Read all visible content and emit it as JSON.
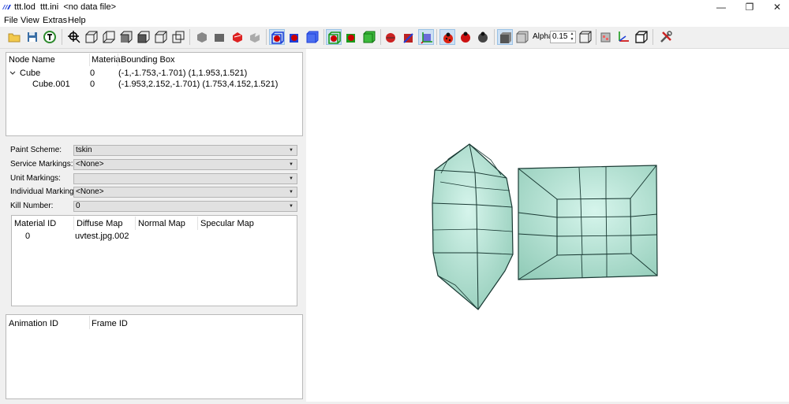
{
  "window": {
    "title": "ttt.lod  ttt.ini  <no data file>",
    "controls": {
      "minimize": "—",
      "restore": "❐",
      "close": "✕"
    }
  },
  "menu": [
    "File",
    "View",
    "Extras",
    "Help"
  ],
  "toolbar": {
    "alpha_label": "Alpha:",
    "alpha_value": "0.15",
    "accent": "#1e3fd8"
  },
  "node_tree": {
    "columns": [
      "Node Name",
      "Materia",
      "Bounding Box"
    ],
    "rows": [
      {
        "name": "Cube",
        "material": "0",
        "bbox": "(-1,-1.753,-1.701) (1,1.953,1.521)",
        "expanded": true,
        "level": 0
      },
      {
        "name": "Cube.001",
        "material": "0",
        "bbox": "(-1.953,2.152,-1.701) (1.753,4.152,1.521)",
        "level": 1
      }
    ]
  },
  "properties": {
    "paint_scheme": {
      "label": "Paint Scheme:",
      "value": "tskin"
    },
    "service_markings": {
      "label": "Service Markings:",
      "value": "<None>"
    },
    "unit_markings": {
      "label": "Unit Markings:",
      "value": ""
    },
    "individual_markings": {
      "label": "Individual Markings:",
      "value": "<None>"
    },
    "kill_number": {
      "label": "Kill Number:",
      "value": "0"
    }
  },
  "materials": {
    "columns": [
      "Material ID",
      "Diffuse Map",
      "Normal Map",
      "Specular Map"
    ],
    "rows": [
      {
        "id": "0",
        "diffuse": "uvtest.jpg.002",
        "normal": "",
        "specular": ""
      }
    ]
  },
  "animations": {
    "columns": [
      "Animation ID",
      "Frame ID"
    ]
  },
  "viewport": {
    "mesh_color": "#a6dccb",
    "mesh_highlight": "#d6f5ec",
    "edge_color": "#1a3a34"
  }
}
